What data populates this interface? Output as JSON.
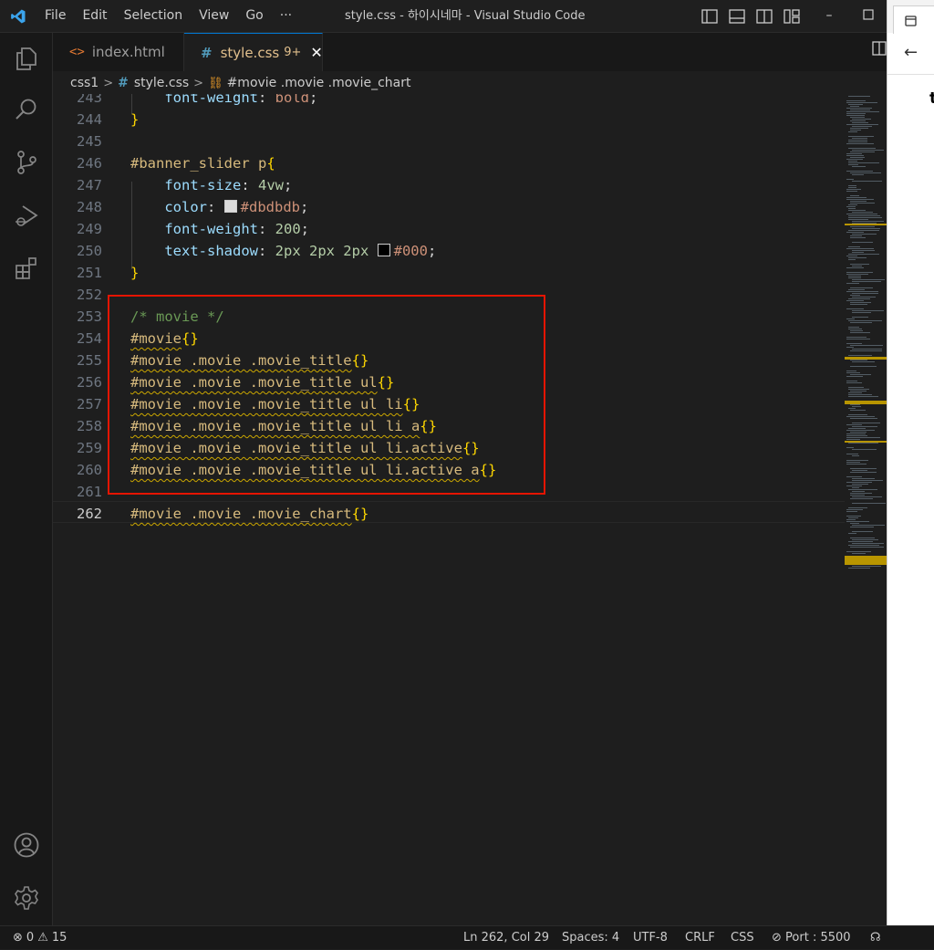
{
  "window": {
    "title": "style.css - 하이시네마 - Visual Studio Code",
    "menu": [
      "File",
      "Edit",
      "Selection",
      "View",
      "Go",
      "···"
    ]
  },
  "tabs": [
    {
      "label": "index.html",
      "icon": "html-icon",
      "active": false
    },
    {
      "label": "style.css",
      "icon": "css-hash-icon",
      "active": true,
      "badge": "9+"
    }
  ],
  "breadcrumb": {
    "folder": "css1",
    "file": "style.css",
    "symbol": "#movie .movie .movie_chart"
  },
  "editor": {
    "current_line": 262,
    "lines": [
      {
        "n": "243",
        "tokens": [
          {
            "t": "    ",
            "c": "plain"
          },
          {
            "t": "font-weight",
            "c": "prop"
          },
          {
            "t": ": ",
            "c": "plain"
          },
          {
            "t": "bold",
            "c": "str"
          },
          {
            "t": ";",
            "c": "plain"
          }
        ]
      },
      {
        "n": "244",
        "tokens": [
          {
            "t": "}",
            "c": "brace"
          }
        ]
      },
      {
        "n": "245",
        "tokens": []
      },
      {
        "n": "246",
        "tokens": [
          {
            "t": "#banner_slider p",
            "c": "sel"
          },
          {
            "t": "{",
            "c": "brace"
          }
        ]
      },
      {
        "n": "247",
        "tokens": [
          {
            "t": "    ",
            "c": "plain"
          },
          {
            "t": "font-size",
            "c": "prop"
          },
          {
            "t": ": ",
            "c": "plain"
          },
          {
            "t": "4vw",
            "c": "num"
          },
          {
            "t": ";",
            "c": "plain"
          }
        ]
      },
      {
        "n": "248",
        "tokens": [
          {
            "t": "    ",
            "c": "plain"
          },
          {
            "t": "color",
            "c": "prop"
          },
          {
            "t": ": ",
            "c": "plain"
          },
          {
            "t": "",
            "c": "swatch",
            "color": "#dbdbdb"
          },
          {
            "t": "#dbdbdb",
            "c": "str"
          },
          {
            "t": ";",
            "c": "plain"
          }
        ]
      },
      {
        "n": "249",
        "tokens": [
          {
            "t": "    ",
            "c": "plain"
          },
          {
            "t": "font-weight",
            "c": "prop"
          },
          {
            "t": ": ",
            "c": "plain"
          },
          {
            "t": "200",
            "c": "num"
          },
          {
            "t": ";",
            "c": "plain"
          }
        ]
      },
      {
        "n": "250",
        "tokens": [
          {
            "t": "    ",
            "c": "plain"
          },
          {
            "t": "text-shadow",
            "c": "prop"
          },
          {
            "t": ": ",
            "c": "plain"
          },
          {
            "t": "2px 2px 2px ",
            "c": "num"
          },
          {
            "t": "",
            "c": "swatch",
            "color": "#000000"
          },
          {
            "t": "#000",
            "c": "str"
          },
          {
            "t": ";",
            "c": "plain"
          }
        ]
      },
      {
        "n": "251",
        "tokens": [
          {
            "t": "}",
            "c": "brace"
          }
        ]
      },
      {
        "n": "252",
        "tokens": []
      },
      {
        "n": "253",
        "tokens": [
          {
            "t": "/* movie */",
            "c": "comment"
          }
        ]
      },
      {
        "n": "254",
        "tokens": [
          {
            "t": "#movie",
            "c": "sel squig"
          },
          {
            "t": "{}",
            "c": "brace"
          }
        ]
      },
      {
        "n": "255",
        "tokens": [
          {
            "t": "#movie .movie .movie_title",
            "c": "sel squig"
          },
          {
            "t": "{}",
            "c": "brace"
          }
        ]
      },
      {
        "n": "256",
        "tokens": [
          {
            "t": "#movie .movie .movie_title ul",
            "c": "sel squig"
          },
          {
            "t": "{}",
            "c": "brace"
          }
        ]
      },
      {
        "n": "257",
        "tokens": [
          {
            "t": "#movie .movie .movie_title ul li",
            "c": "sel squig"
          },
          {
            "t": "{}",
            "c": "brace"
          }
        ]
      },
      {
        "n": "258",
        "tokens": [
          {
            "t": "#movie .movie .movie_title ul li a",
            "c": "sel squig"
          },
          {
            "t": "{}",
            "c": "brace"
          }
        ]
      },
      {
        "n": "259",
        "tokens": [
          {
            "t": "#movie .movie .movie_title ul li.active",
            "c": "sel squig"
          },
          {
            "t": "{}",
            "c": "brace"
          }
        ]
      },
      {
        "n": "260",
        "tokens": [
          {
            "t": "#movie .movie .movie_title ul li.active a",
            "c": "sel squig"
          },
          {
            "t": "{}",
            "c": "brace"
          }
        ]
      },
      {
        "n": "261",
        "tokens": []
      },
      {
        "n": "262",
        "tokens": [
          {
            "t": "#movie .movie .movie_chart",
            "c": "sel squig"
          },
          {
            "t": "{}",
            "c": "brace"
          }
        ]
      }
    ]
  },
  "browser_panel": {
    "partial_char": "t"
  },
  "statusbar": {
    "errors": "0",
    "warnings": "15",
    "position": "Ln 262, Col 29",
    "spaces": "Spaces: 4",
    "encoding": "UTF-8",
    "eol": "CRLF",
    "language": "CSS",
    "port": "Port : 5500"
  },
  "colors": {
    "accent": "#0078d4",
    "highlight_box": "#e51400",
    "warning": "#cca700"
  }
}
